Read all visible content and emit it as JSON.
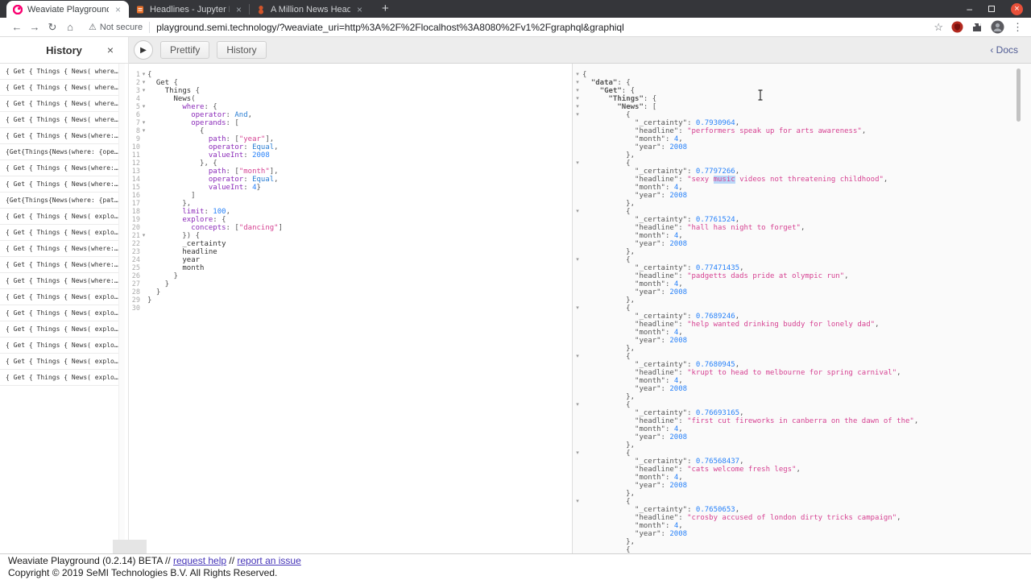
{
  "browser": {
    "tabs": [
      {
        "title": "Weaviate Playground",
        "active": true,
        "icon": "weaviate-favicon-icon"
      },
      {
        "title": "Headlines - Jupyter Noteb",
        "active": false,
        "icon": "jupyter-favicon-icon"
      },
      {
        "title": "A Million News Headlines",
        "active": false,
        "icon": "dataset-favicon-icon"
      }
    ],
    "security_label": "Not secure",
    "url": "playground.semi.technology/?weaviate_uri=http%3A%2F%2Flocalhost%3A8080%2Fv1%2Fgraphql&graphiql"
  },
  "icons": {
    "back": "←",
    "forward": "→",
    "reload": "↻",
    "home": "⌂",
    "warning": "⚠",
    "star": "☆",
    "menu_dots": "⋮",
    "minimize": "–",
    "close_x": "×",
    "play": "▶",
    "tab_close": "×",
    "new_tab": "+",
    "fold_arrow": "▾",
    "docs_chevron": "‹"
  },
  "toolbar": {
    "prettify": "Prettify",
    "history": "History",
    "docs": "Docs"
  },
  "history_panel": {
    "title": "History",
    "close": "×",
    "items": [
      "{ Get { Things { News( where…",
      "{ Get { Things { News( where…",
      "{ Get { Things { News( where…",
      "{ Get { Things { News( where…",
      "{ Get { Things { News(where:…",
      "{Get{Things{News(where: {ope…",
      "{ Get { Things { News(where:…",
      "{ Get { Things { News(where:…",
      "{Get{Things{News(where: {pat…",
      "{ Get { Things { News( explo…",
      "{ Get { Things { News( explo…",
      "{ Get { Things { News(where:…",
      "{ Get { Things { News(where:…",
      "{ Get { Things { News(where:…",
      "{ Get { Things { News( explo…",
      "{ Get { Things { News( explo…",
      "{ Get { Things { News( explo…",
      "{ Get { Things { News( explo…",
      "{ Get { Things { News( explo…",
      "{ Get { Things { News( explo…"
    ]
  },
  "editor": {
    "lines": [
      [
        1,
        1,
        [
          [
            "p",
            "{"
          ]
        ]
      ],
      [
        2,
        1,
        [
          [
            "p",
            "  "
          ],
          [
            "fld",
            "Get"
          ],
          [
            "p",
            " {"
          ]
        ]
      ],
      [
        3,
        1,
        [
          [
            "p",
            "    "
          ],
          [
            "fld",
            "Things"
          ],
          [
            "p",
            " {"
          ]
        ]
      ],
      [
        4,
        0,
        [
          [
            "p",
            "      "
          ],
          [
            "fld",
            "News"
          ],
          [
            "p",
            "("
          ]
        ]
      ],
      [
        5,
        1,
        [
          [
            "p",
            "        "
          ],
          [
            "arg",
            "where"
          ],
          [
            "p",
            ": {"
          ]
        ]
      ],
      [
        6,
        0,
        [
          [
            "p",
            "          "
          ],
          [
            "arg",
            "operator"
          ],
          [
            "p",
            ": "
          ],
          [
            "enm",
            "And"
          ],
          [
            "p",
            ","
          ]
        ]
      ],
      [
        7,
        1,
        [
          [
            "p",
            "          "
          ],
          [
            "arg",
            "operands"
          ],
          [
            "p",
            ": ["
          ]
        ]
      ],
      [
        8,
        1,
        [
          [
            "p",
            "            {"
          ]
        ]
      ],
      [
        9,
        0,
        [
          [
            "p",
            "              "
          ],
          [
            "arg",
            "path"
          ],
          [
            "p",
            ": ["
          ],
          [
            "str",
            "\"year\""
          ],
          [
            "p",
            "],"
          ]
        ]
      ],
      [
        10,
        0,
        [
          [
            "p",
            "              "
          ],
          [
            "arg",
            "operator"
          ],
          [
            "p",
            ": "
          ],
          [
            "enm",
            "Equal"
          ],
          [
            "p",
            ","
          ]
        ]
      ],
      [
        11,
        0,
        [
          [
            "p",
            "              "
          ],
          [
            "arg",
            "valueInt"
          ],
          [
            "p",
            ": "
          ],
          [
            "num",
            "2008"
          ]
        ]
      ],
      [
        12,
        0,
        [
          [
            "p",
            "            }, {"
          ]
        ]
      ],
      [
        13,
        0,
        [
          [
            "p",
            "              "
          ],
          [
            "arg",
            "path"
          ],
          [
            "p",
            ": ["
          ],
          [
            "str",
            "\"month\""
          ],
          [
            "p",
            "],"
          ]
        ]
      ],
      [
        14,
        0,
        [
          [
            "p",
            "              "
          ],
          [
            "arg",
            "operator"
          ],
          [
            "p",
            ": "
          ],
          [
            "enm",
            "Equal"
          ],
          [
            "p",
            ","
          ]
        ]
      ],
      [
        15,
        0,
        [
          [
            "p",
            "              "
          ],
          [
            "arg",
            "valueInt"
          ],
          [
            "p",
            ": "
          ],
          [
            "num",
            "4"
          ],
          [
            "p",
            "}"
          ]
        ]
      ],
      [
        16,
        0,
        [
          [
            "p",
            "          ]"
          ]
        ]
      ],
      [
        17,
        0,
        [
          [
            "p",
            "        },"
          ]
        ]
      ],
      [
        18,
        0,
        [
          [
            "p",
            "        "
          ],
          [
            "arg",
            "limit"
          ],
          [
            "p",
            ": "
          ],
          [
            "num",
            "100"
          ],
          [
            "p",
            ","
          ]
        ]
      ],
      [
        19,
        0,
        [
          [
            "p",
            "        "
          ],
          [
            "arg",
            "explore"
          ],
          [
            "p",
            ": {"
          ]
        ]
      ],
      [
        20,
        0,
        [
          [
            "p",
            "          "
          ],
          [
            "arg",
            "concepts"
          ],
          [
            "p",
            ": ["
          ],
          [
            "str",
            "\"dancing\""
          ],
          [
            "p",
            "]"
          ]
        ]
      ],
      [
        21,
        1,
        [
          [
            "p",
            "        }) {"
          ]
        ]
      ],
      [
        22,
        0,
        [
          [
            "p",
            "        "
          ],
          [
            "fld",
            "_certainty"
          ]
        ]
      ],
      [
        23,
        0,
        [
          [
            "p",
            "        "
          ],
          [
            "fld",
            "headline"
          ]
        ]
      ],
      [
        24,
        0,
        [
          [
            "p",
            "        "
          ],
          [
            "fld",
            "year"
          ]
        ]
      ],
      [
        25,
        0,
        [
          [
            "p",
            "        "
          ],
          [
            "fld",
            "month"
          ]
        ]
      ],
      [
        26,
        0,
        [
          [
            "p",
            "      }"
          ]
        ]
      ],
      [
        27,
        0,
        [
          [
            "p",
            "    }"
          ]
        ]
      ],
      [
        28,
        0,
        [
          [
            "p",
            "  }"
          ]
        ]
      ],
      [
        29,
        0,
        [
          [
            "p",
            "}"
          ]
        ]
      ],
      [
        30,
        0,
        []
      ]
    ]
  },
  "response": {
    "root": [
      {
        "key": "data",
        "bracket": "{"
      },
      {
        "key": "Get",
        "bracket": "{"
      },
      {
        "key": "Things",
        "bracket": "{"
      },
      {
        "key": "News",
        "bracket": "["
      }
    ],
    "entries": [
      {
        "certainty": "0.7930964",
        "headline": "performers speak up for arts awareness",
        "month": "4",
        "year": "2008"
      },
      {
        "certainty": "0.7797266",
        "headline": "sexy music videos not threatening childhood",
        "month": "4",
        "year": "2008"
      },
      {
        "certainty": "0.7761524",
        "headline": "hall has night to forget",
        "month": "4",
        "year": "2008"
      },
      {
        "certainty": "0.77471435",
        "headline": "padgetts dads pride at olympic run",
        "month": "4",
        "year": "2008"
      },
      {
        "certainty": "0.7689246",
        "headline": "help wanted drinking buddy for lonely dad",
        "month": "4",
        "year": "2008"
      },
      {
        "certainty": "0.7680945",
        "headline": "krupt to head to melbourne for spring carnival",
        "month": "4",
        "year": "2008"
      },
      {
        "certainty": "0.76693165",
        "headline": "first cut fireworks in canberra on the dawn of the",
        "month": "4",
        "year": "2008"
      },
      {
        "certainty": "0.76568437",
        "headline": "cats welcome fresh legs",
        "month": "4",
        "year": "2008"
      },
      {
        "certainty": "0.7650653",
        "headline": "crosby accused of london dirty tricks campaign",
        "month": "4",
        "year": "2008"
      }
    ],
    "highlight": {
      "entry_index": 1,
      "word": "music"
    },
    "partial_next_entry": true
  },
  "footer": {
    "line1_prefix": "Weaviate Playground (0.2.14) BETA // ",
    "link1": "request help",
    "sep": " // ",
    "link2": "report an issue",
    "line2": "Copyright © 2019 SeMI Technologies B.V. All Rights Reserved."
  },
  "colors": {
    "accent_pink": "#fa0171",
    "syntax_argument": "#8b2bb9",
    "syntax_enum": "#2a7ed3",
    "syntax_number": "#2882f9",
    "syntax_string": "#d64292",
    "selection_highlight": "#b9d8f9",
    "close_button": "#e8503a",
    "footer_link": "#4534b8"
  }
}
